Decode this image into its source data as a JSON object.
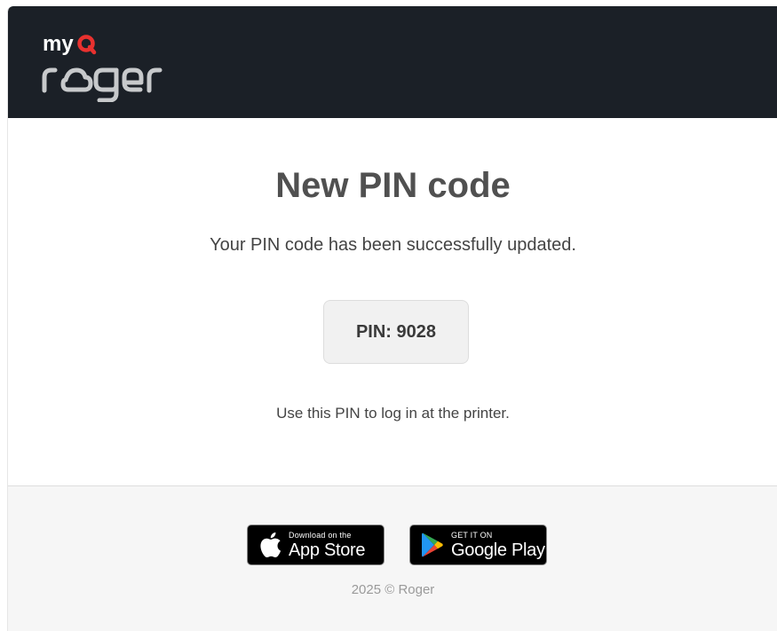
{
  "header": {
    "logo_top_text": "myq",
    "logo_bottom_text": "roger",
    "background_color": "#1b2027",
    "accent_color": "#e8312f"
  },
  "main": {
    "title": "New PIN code",
    "subtitle": "Your PIN code has been successfully updated.",
    "pin_label": "PIN: 9028",
    "hint": "Use this PIN to log in at the printer."
  },
  "footer": {
    "app_store": {
      "small": "Download on the",
      "big": "App Store",
      "icon": "apple-icon"
    },
    "google_play": {
      "small": "GET IT ON",
      "big": "Google Play",
      "icon": "google-play-icon"
    },
    "copyright": "2025 © Roger"
  }
}
